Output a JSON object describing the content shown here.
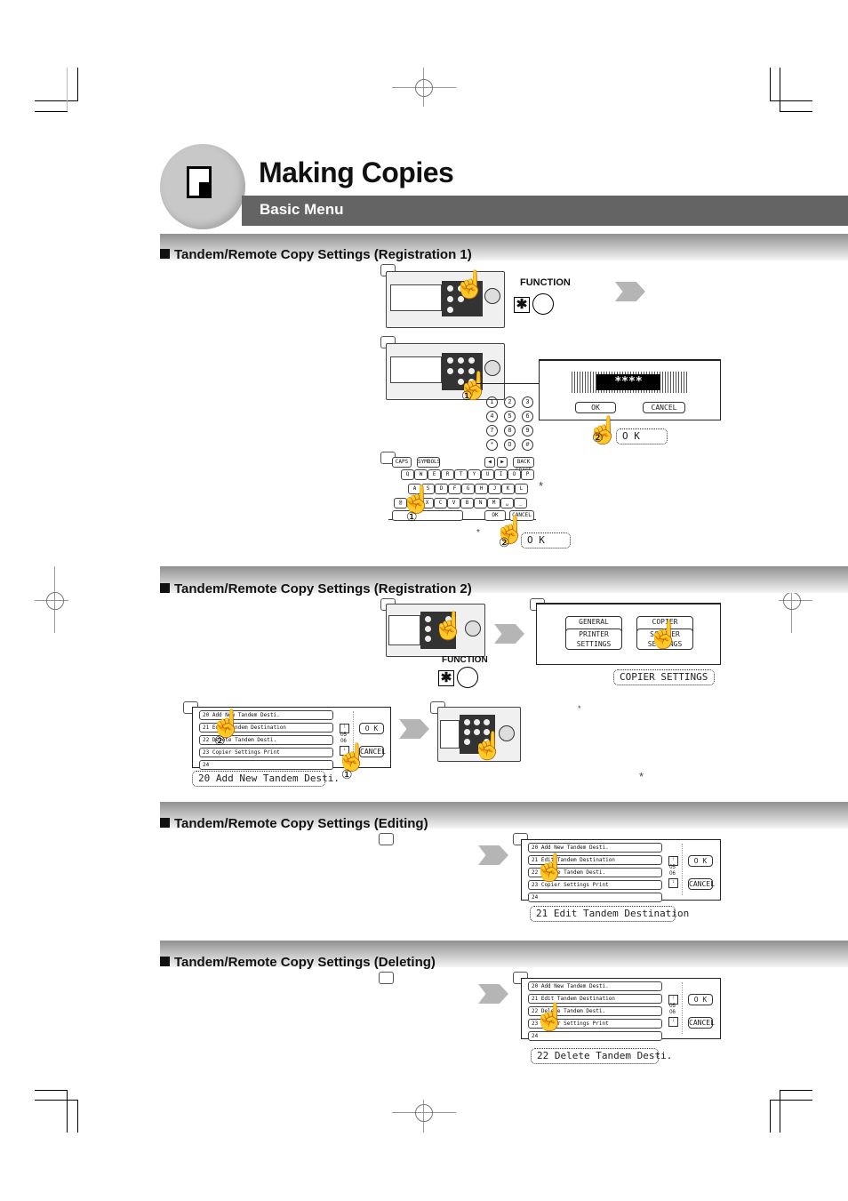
{
  "header": {
    "chapter_title": "Making Copies",
    "subtitle": "Basic Menu",
    "chapter_icon": "document-page-icon"
  },
  "sections": [
    {
      "title": "Tandem/Remote Copy Settings (Registration 1)",
      "function_label": "FUNCTION",
      "function_key_symbol": "✱",
      "password_mask": "****",
      "dialog_ok": "OK",
      "dialog_cancel": "CANCEL",
      "callout_ok": "O K",
      "keypad_keys": [
        "1",
        "2",
        "3",
        "4",
        "5",
        "6",
        "7",
        "8",
        "9",
        "*",
        "0",
        "#"
      ],
      "circled_1": "①",
      "circled_2": "②",
      "keyboard": {
        "top_keys": [
          "CAPS",
          "SYMBOLS",
          "◀",
          "▶",
          "BACK SPACE"
        ],
        "row1": [
          "Q",
          "W",
          "E",
          "R",
          "T",
          "Y",
          "U",
          "I",
          "O",
          "P"
        ],
        "row2": [
          "A",
          "S",
          "D",
          "F",
          "G",
          "H",
          "J",
          "K",
          "L"
        ],
        "row3": [
          "@",
          "Z",
          "X",
          "C",
          "V",
          "B",
          "N",
          "M",
          "␣",
          "_"
        ],
        "ok": "OK",
        "cancel": "CANCEL"
      },
      "callout_ok_2": "O K",
      "note_marks": [
        "*",
        "*"
      ]
    },
    {
      "title": "Tandem/Remote Copy Settings (Registration 2)",
      "function_label": "FUNCTION",
      "function_key_symbol": "✱",
      "menu_buttons": [
        "GENERAL SETTINGS",
        "COPIER SETTINGS",
        "PRINTER SETTINGS",
        "SCANNER SETTINGS"
      ],
      "callout_copier": "COPIER SETTINGS",
      "list_items": [
        "20  Add New Tandem Desti.",
        "21  Edit Tandem Destination",
        "22  Delete Tandem Desti.",
        "23  Copier Settings Print",
        "24"
      ],
      "page_indicator": {
        "current": "05",
        "total": "06"
      },
      "list_ok": "O K",
      "list_cancel": "CANCEL",
      "callout_add": "20  Add New Tandem Desti.",
      "note_marks": [
        "*",
        "*"
      ]
    },
    {
      "title": "Tandem/Remote Copy Settings (Editing)",
      "list_items": [
        "20  Add New Tandem Desti.",
        "21  Edit Tandem Destination",
        "22  Delete Tandem Desti.",
        "23  Copier Settings Print",
        "24"
      ],
      "page_indicator": {
        "current": "05",
        "total": "06"
      },
      "list_ok": "O K",
      "list_cancel": "CANCEL",
      "callout": "21  Edit Tandem Destination"
    },
    {
      "title": "Tandem/Remote Copy Settings (Deleting)",
      "list_items": [
        "20  Add New Tandem Desti.",
        "21  Edit Tandem Destination",
        "22  Delete Tandem Desti.",
        "23  Copier Settings Print",
        "24"
      ],
      "page_indicator": {
        "current": "05",
        "total": "06"
      },
      "list_ok": "O K",
      "list_cancel": "CANCEL",
      "callout": "22  Delete Tandem Desti."
    }
  ],
  "icons": {
    "hand": "☝",
    "arrow_up": "↑",
    "arrow_down": "↓"
  }
}
